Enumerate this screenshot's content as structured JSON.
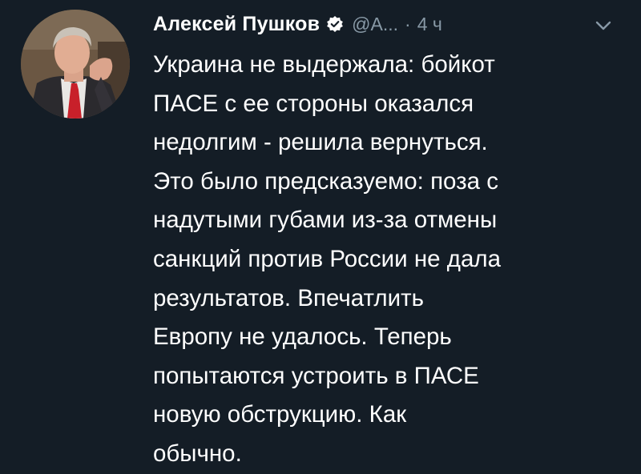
{
  "tweet": {
    "author_name": "Алексей Пушков",
    "handle": "@A...",
    "separator": "·",
    "time": "4 ч",
    "lines": [
      "Украина не выдержала: бойкот",
      "ПАСЕ с ее стороны оказался",
      "недолгим - решила вернуться.",
      "Это было предсказуемо: поза с",
      "надутыми губами из-за отмены",
      "санкций против России не дала",
      "результатов. Впечатлить",
      "Европу не удалось. Теперь",
      "попытаются устроить в ПАСЕ",
      "новую обструкцию. Как",
      "обычно."
    ]
  },
  "icons": {
    "verified": "verified-badge-icon",
    "menu": "chevron-down-icon"
  },
  "colors": {
    "background": "#141d26",
    "text": "#ffffff",
    "muted": "#8899a6"
  }
}
